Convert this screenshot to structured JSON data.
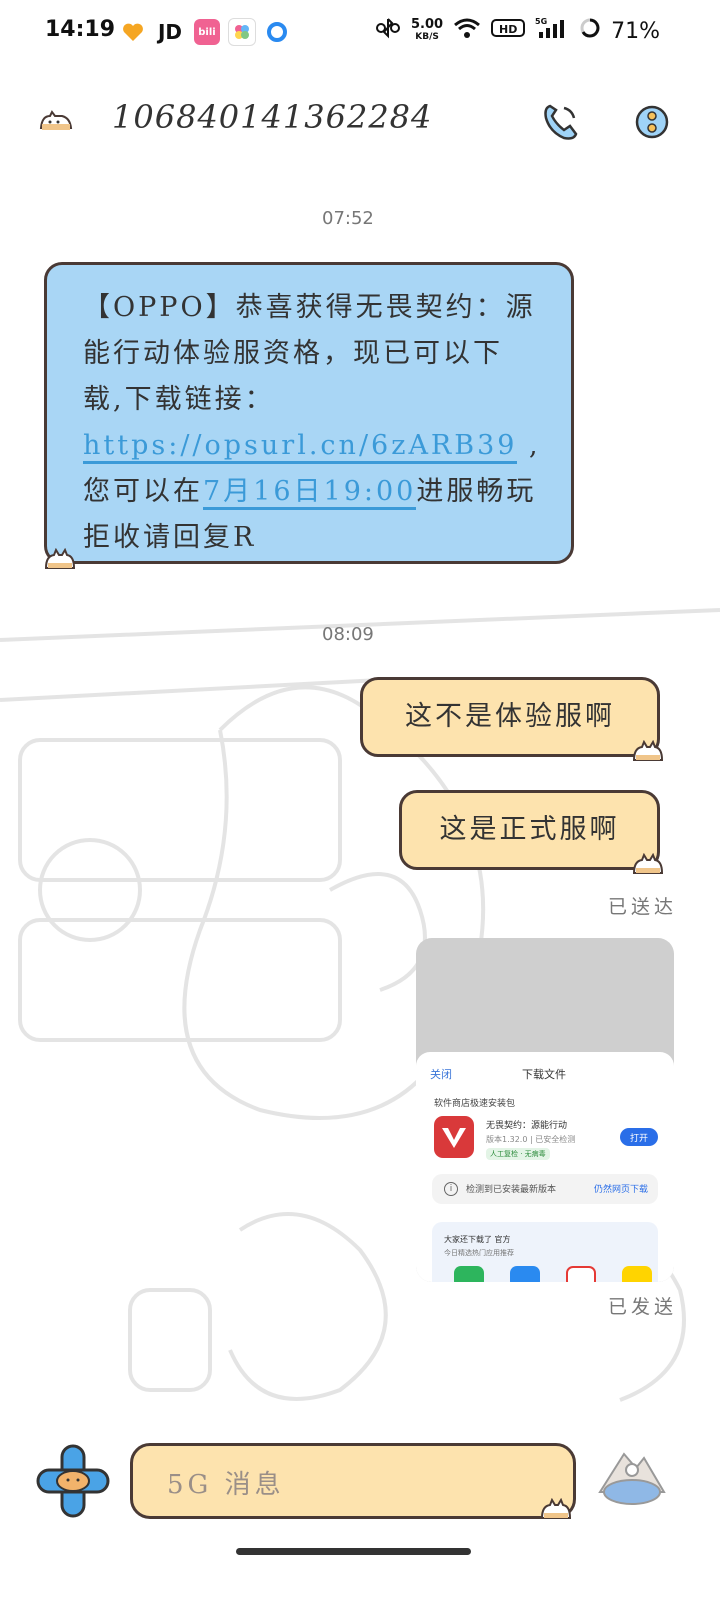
{
  "status_bar": {
    "time": "14:19",
    "app_icons": [
      "heart-app-icon",
      "jd-icon",
      "bilibili-icon",
      "gallery-app-icon",
      "browser-app-icon"
    ],
    "jd_label": "JD",
    "bili_label": "bili",
    "speed_value": "5.00",
    "speed_unit": "KB/S",
    "battery": "71%"
  },
  "header": {
    "title": "106840141362284"
  },
  "messages": {
    "time1": "07:52",
    "incoming_text_before": "【OPPO】恭喜获得无畏契约：源能行动体验服资格，现已可以下载,下载链接：",
    "incoming_link": "https://opsurl.cn/6zARB39",
    "incoming_text_mid": " ,您可以在",
    "incoming_date": "7月16日19:00",
    "incoming_text_after": "进服畅玩 拒收请回复R",
    "time2": "08:09",
    "outgoing1": "这不是体验服啊",
    "outgoing2": "这是正式服啊",
    "delivered": "已送达",
    "sent": "已发送"
  },
  "thumbnail": {
    "close": "关闭",
    "title": "下载文件",
    "subtitle": "软件商店极速安装包",
    "app_name": "无畏契约：源能行动",
    "app_meta": "版本1.32.0 | 已安全检测",
    "app_badge": "人工复检 · 无病毒",
    "open": "打开",
    "notice_text": "检测到已安装最新版本",
    "notice_link": "仍然网页下载",
    "rec_title": "大家还下载了 官方",
    "rec_sub": "今日精选热门应用推荐"
  },
  "input": {
    "placeholder": "5G 消息"
  },
  "colors": {
    "incoming_bubble": "#a9d6f5",
    "outgoing_bubble": "#fde3ae",
    "link": "#3b9ad8",
    "border": "#4a3a35"
  }
}
